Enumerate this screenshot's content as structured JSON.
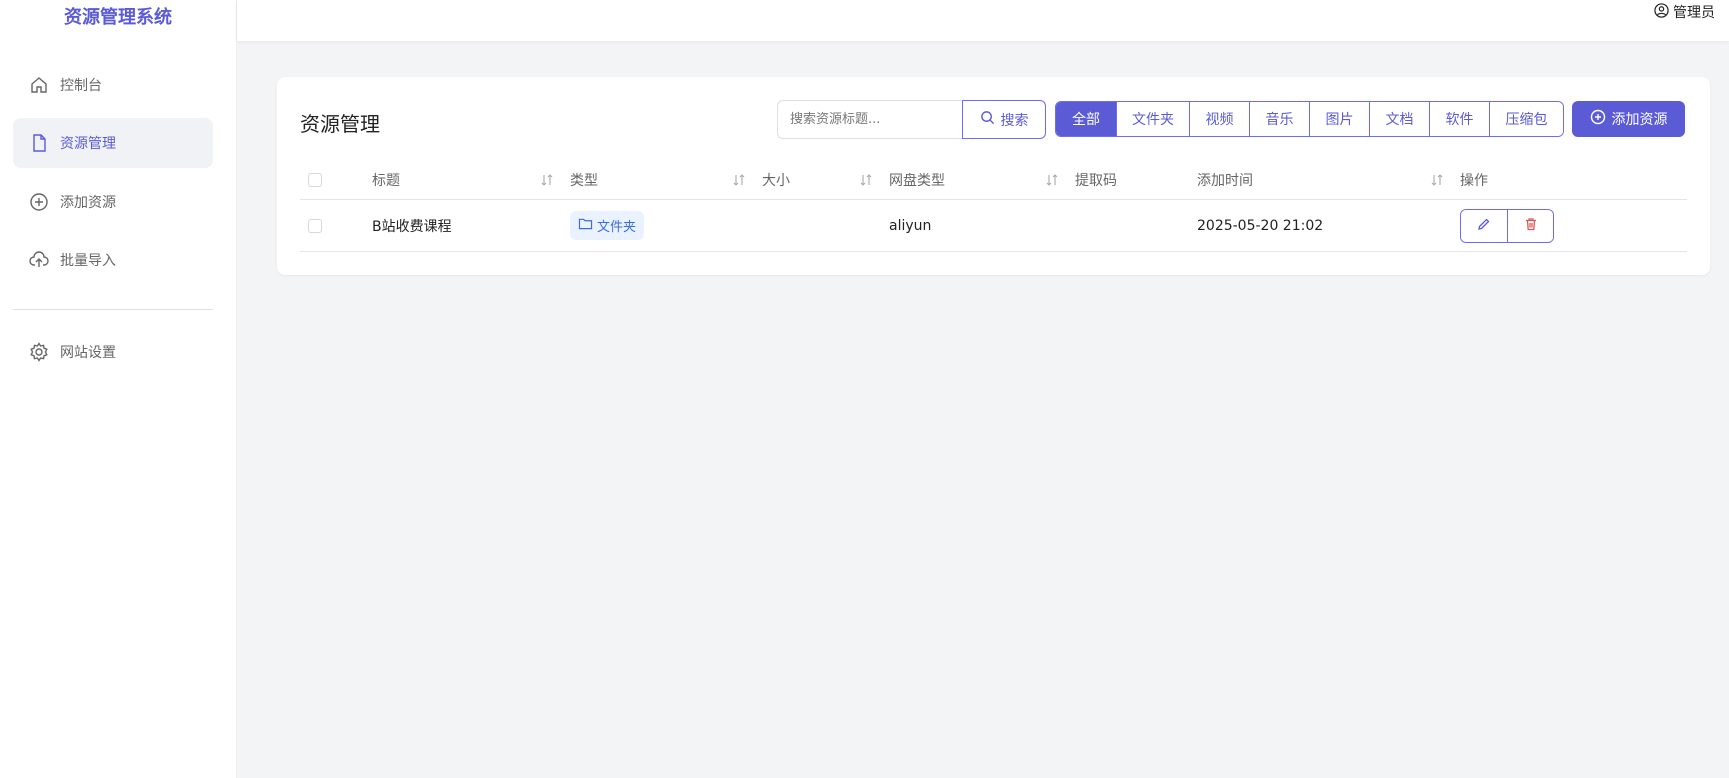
{
  "app": {
    "title": "资源管理系统"
  },
  "header": {
    "user_label": "管理员"
  },
  "sidebar": {
    "items": [
      {
        "label": "控制台",
        "icon": "home-icon"
      },
      {
        "label": "资源管理",
        "icon": "file-icon",
        "active": true
      },
      {
        "label": "添加资源",
        "icon": "plus-circle-icon"
      },
      {
        "label": "批量导入",
        "icon": "cloud-upload-icon"
      },
      {
        "label": "网站设置",
        "icon": "gear-icon"
      }
    ]
  },
  "main": {
    "title": "资源管理",
    "search": {
      "placeholder": "搜索资源标题...",
      "value": "",
      "button_label": "搜索"
    },
    "filters": [
      {
        "label": "全部",
        "active": true
      },
      {
        "label": "文件夹"
      },
      {
        "label": "视频"
      },
      {
        "label": "音乐"
      },
      {
        "label": "图片"
      },
      {
        "label": "文档"
      },
      {
        "label": "软件"
      },
      {
        "label": "压缩包"
      }
    ],
    "add_button_label": "添加资源",
    "table": {
      "columns": [
        "标题",
        "类型",
        "大小",
        "网盘类型",
        "提取码",
        "添加时间",
        "操作"
      ],
      "rows": [
        {
          "title": "B站收费课程",
          "type": "文件夹",
          "size": "",
          "disk_type": "aliyun",
          "code": "",
          "added_time": "2025-05-20 21:02"
        }
      ]
    }
  },
  "colors": {
    "accent": "#5b5bd6",
    "tag_bg": "#eaf2ff",
    "danger": "#e05555"
  }
}
